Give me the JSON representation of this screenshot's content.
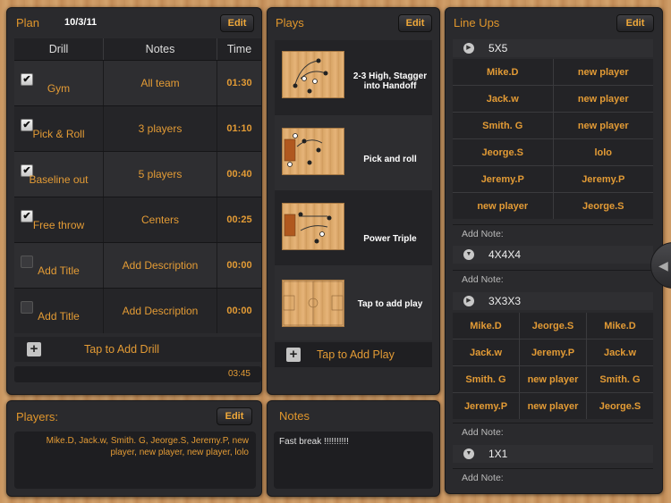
{
  "plan": {
    "title": "Plan",
    "date": "10/3/11",
    "edit_label": "Edit",
    "columns": [
      "Drill",
      "Notes",
      "Time"
    ],
    "drills": [
      {
        "title": "Gym",
        "notes": "All team",
        "time": "01:30",
        "checked": true
      },
      {
        "title": "Pick & Roll",
        "notes": "3 players",
        "time": "01:10",
        "checked": true
      },
      {
        "title": "Baseline out",
        "notes": "5 players",
        "time": "00:40",
        "checked": true
      },
      {
        "title": "Free throw",
        "notes": "Centers",
        "time": "00:25",
        "checked": true
      },
      {
        "title": "Add Title",
        "notes": "Add Description",
        "time": "00:00",
        "checked": false
      },
      {
        "title": "Add Title",
        "notes": "Add Description",
        "time": "00:00",
        "checked": false
      }
    ],
    "add_drill_label": "Tap to Add Drill",
    "total_time": "03:45",
    "check_mark": "✔"
  },
  "plays": {
    "title": "Plays",
    "edit_label": "Edit",
    "items": [
      {
        "name": "2-3 High, Stagger into Handoff"
      },
      {
        "name": "Pick and roll"
      },
      {
        "name": "Power Triple"
      },
      {
        "name": "Tap to add play"
      }
    ],
    "add_play_label": "Tap to Add Play"
  },
  "lineups": {
    "title": "Line Ups",
    "edit_label": "Edit",
    "note_label": "Add Note:",
    "sections": [
      {
        "name": "5X5",
        "expanded": true,
        "cols": 2,
        "players": [
          "Mike.D",
          "new player",
          "Jack.w",
          "new player",
          "Smith. G",
          "new player",
          "Jeorge.S",
          "lolo",
          "Jeremy.P",
          "Jeremy.P",
          "new player",
          "Jeorge.S"
        ]
      },
      {
        "name": "4X4X4",
        "expanded": false
      },
      {
        "name": "3X3X3",
        "expanded": true,
        "cols": 3,
        "players": [
          "Mike.D",
          "Jeorge.S",
          "Mike.D",
          "Jack.w",
          "Jeremy.P",
          "Jack.w",
          "Smith. G",
          "new player",
          "Smith. G",
          "Jeremy.P",
          "new player",
          "Jeorge.S"
        ]
      },
      {
        "name": "1X1",
        "expanded": false
      }
    ]
  },
  "players": {
    "title": "Players:",
    "edit_label": "Edit",
    "list": "Mike.D, Jack.w, Smith. G, Jeorge.S, Jeremy.P, new player, new player, new player, lolo"
  },
  "notes": {
    "title": "Notes",
    "text": "Fast break !!!!!!!!!!"
  },
  "icons": {
    "plus": "+",
    "expanded_arrow": "▶",
    "collapsed_arrow": "▼",
    "side_arrow": "◀"
  },
  "colors": {
    "accent": "#e39b35",
    "panel": "#2a2a2d"
  }
}
